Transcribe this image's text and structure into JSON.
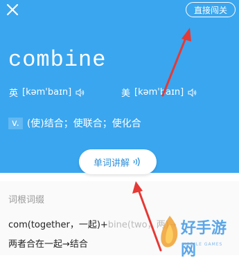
{
  "header": {
    "close_icon": "close-icon",
    "skip_label": "直接闯关"
  },
  "word": {
    "text": "combine",
    "uk": {
      "tag": "英",
      "ipa": "[kəm'baɪn]",
      "icon": "speaker-icon"
    },
    "us": {
      "tag": "美",
      "ipa": "[kəm'baɪn]",
      "icon": "speaker-icon"
    }
  },
  "definition": {
    "pos": "v.",
    "meaning": "(使)结合；使联合；使化合"
  },
  "explain_button": {
    "label": "单词讲解",
    "icon": "sound-waves-icon"
  },
  "etymology": {
    "title": "词根词缀",
    "line1_a": "com(together，一起)+",
    "line1_b": "bine(two，两)→",
    "line2": "两者合在一起→结合"
  },
  "watermark": {
    "text": "好手游网",
    "sub": "MOBILE GAMES"
  },
  "colors": {
    "header_bg": "#3aa6ef",
    "accent_text": "#2f90da",
    "arrow": "#e53935"
  }
}
